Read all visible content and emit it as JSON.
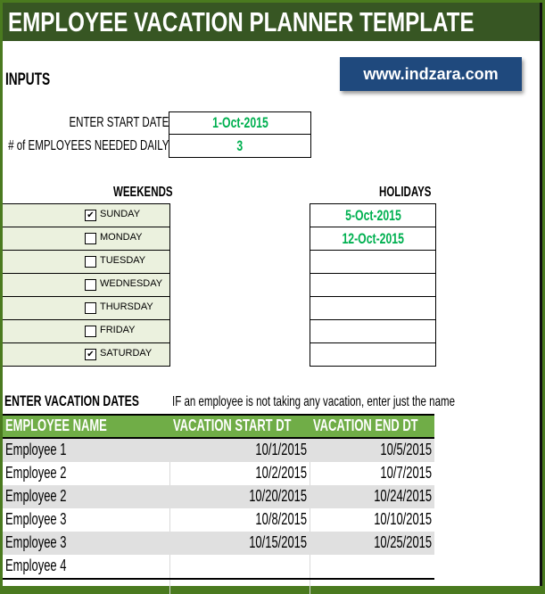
{
  "title": "EMPLOYEE VACATION PLANNER TEMPLATE",
  "inputs_heading": "INPUTS",
  "brand_link": "www.indzara.com",
  "inputs": {
    "start_date_label": "ENTER START DATE",
    "start_date_value": "1-Oct-2015",
    "employees_needed_label": "# of EMPLOYEES NEEDED DAILY",
    "employees_needed_value": "3"
  },
  "weekends": {
    "heading": "WEEKENDS",
    "days": [
      {
        "label": "SUNDAY",
        "checked": true
      },
      {
        "label": "MONDAY",
        "checked": false
      },
      {
        "label": "TUESDAY",
        "checked": false
      },
      {
        "label": "WEDNESDAY",
        "checked": false
      },
      {
        "label": "THURSDAY",
        "checked": false
      },
      {
        "label": "FRIDAY",
        "checked": false
      },
      {
        "label": "SATURDAY",
        "checked": true
      }
    ]
  },
  "holidays": {
    "heading": "HOLIDAYS",
    "dates": [
      "5-Oct-2015",
      "12-Oct-2015",
      "",
      "",
      "",
      "",
      ""
    ]
  },
  "vacation": {
    "heading": "ENTER VACATION DATES",
    "note": "IF an employee is not taking any vacation, enter just the name",
    "columns": [
      "EMPLOYEE NAME",
      "VACATION START DT",
      "VACATION END DT"
    ],
    "rows": [
      [
        "Employee 1",
        "10/1/2015",
        "10/5/2015"
      ],
      [
        "Employee 2",
        "10/2/2015",
        "10/7/2015"
      ],
      [
        "Employee 2",
        "10/20/2015",
        "10/24/2015"
      ],
      [
        "Employee 3",
        "10/8/2015",
        "10/10/2015"
      ],
      [
        "Employee 3",
        "10/15/2015",
        "10/25/2015"
      ],
      [
        "Employee 4",
        "",
        ""
      ]
    ]
  },
  "colors": {
    "title_bg": "#375623",
    "frame": "#4a7a1f",
    "brand_bg": "#1f497d",
    "value_green": "#00b050",
    "table_header": "#70ad47",
    "weekend_bg": "#ebf1de"
  }
}
